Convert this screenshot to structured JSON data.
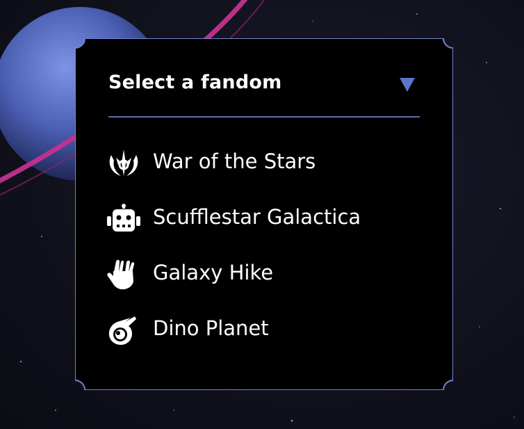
{
  "dropdown": {
    "title": "Select a fandom",
    "toggle_icon": "triangle-down-icon",
    "accent_color": "#5b76c9",
    "options": [
      {
        "label": "War of the Stars",
        "icon": "jedi-emblem-icon"
      },
      {
        "label": " Scufflestar Galactica",
        "icon": "robot-icon"
      },
      {
        "label": "Galaxy Hike",
        "icon": "vulcan-salute-icon"
      },
      {
        "label": "Dino Planet",
        "icon": "meteor-icon"
      }
    ]
  }
}
